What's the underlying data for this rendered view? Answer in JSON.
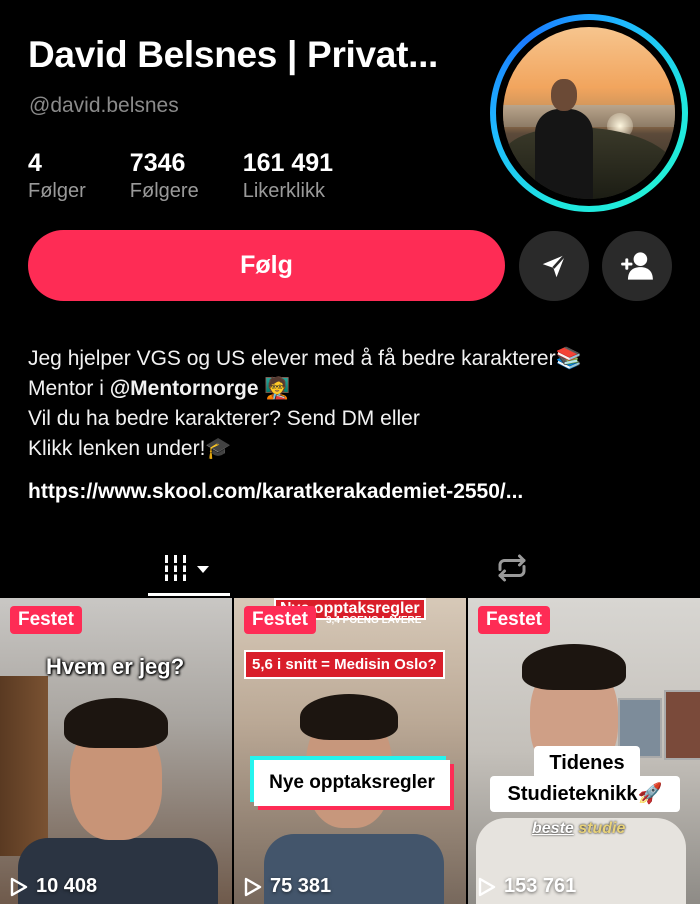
{
  "profile": {
    "display_name": "David Belsnes | Privat...",
    "username": "@david.belsnes",
    "stats": [
      {
        "value": "4",
        "label": "Følger"
      },
      {
        "value": "7346",
        "label": "Følgere"
      },
      {
        "value": "161 491",
        "label": "Likerklikk"
      }
    ],
    "follow_label": "Følg",
    "bio": {
      "line1": "Jeg hjelper VGS og US elever med å få bedre karakterer📚",
      "line2_prefix": "Mentor i ",
      "line2_mention": "@Mentornorge",
      "line2_suffix": " 🧑‍🏫",
      "line3": "Vil du ha bedre karakterer? Send DM eller",
      "line4": "Klikk lenken under!🎓"
    },
    "link": "https://www.skool.com/karatkerakademiet-2550/..."
  },
  "colors": {
    "accent": "#fe2c55",
    "background": "#000000",
    "secondary_text": "#8a8a8a",
    "ring_cyan": "#1fe6e0",
    "ring_blue": "#1a7bff"
  },
  "tabs": {
    "videos_icon": "grid-icon",
    "reposts_icon": "repost-icon"
  },
  "videos": [
    {
      "pinned_label": "Festet",
      "caption": "Hvem er jeg?",
      "views": "10 408"
    },
    {
      "pinned_label": "Festet",
      "overlay_top": "Nye opptaksregler",
      "overlay_sub": "3,4 POENG LAVERE",
      "red_caption": "5,6 i snitt = Medisin Oslo?",
      "caption": "Nye opptaksregler",
      "views": "75 381"
    },
    {
      "pinned_label": "Festet",
      "caption_line1": "Tidenes",
      "caption_line2": "Studieteknikk🚀",
      "watermark_a": "beste",
      "watermark_b": "studie",
      "views": "153 761"
    }
  ]
}
